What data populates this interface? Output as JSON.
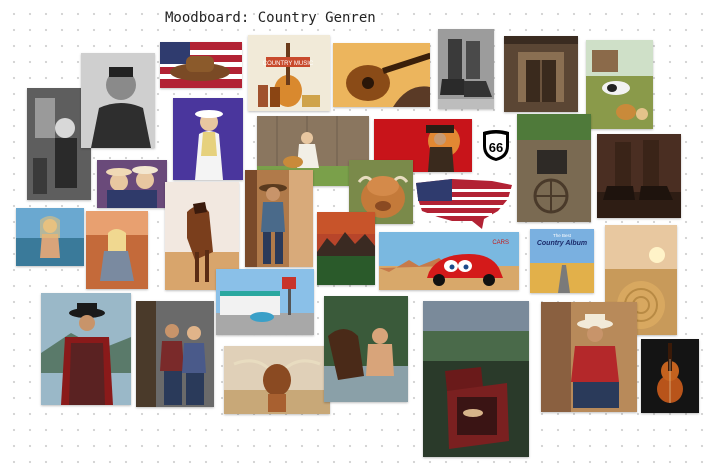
{
  "board": {
    "title": "Moodboard: Country Genren"
  },
  "cards": {
    "route66": "66",
    "cars": "CARS",
    "album_title": "The Best",
    "album_name": "Country Album",
    "music_sign": "COUNTRY MUSIC"
  }
}
